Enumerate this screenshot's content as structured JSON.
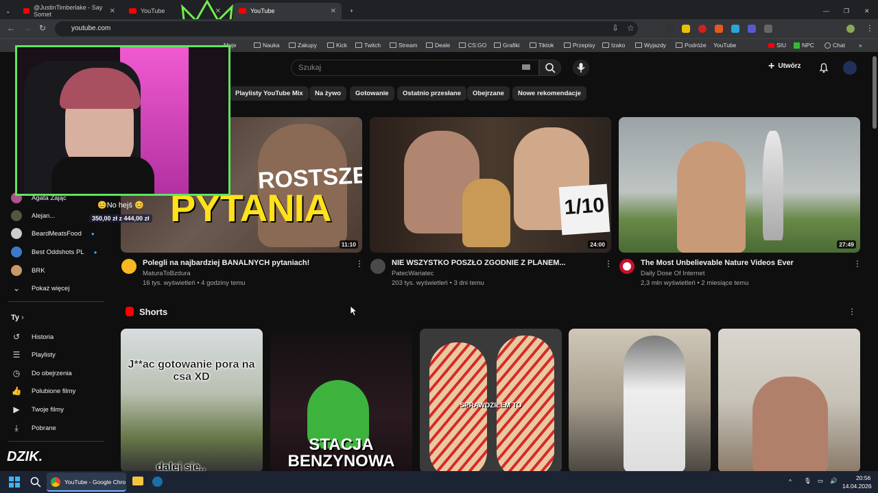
{
  "browser": {
    "tabs": [
      {
        "label": "@JustinTimberlake - Say Somet"
      },
      {
        "label": "YouTube"
      },
      {
        "label": "YouTube"
      }
    ],
    "url": "youtube.com",
    "bookmarks": [
      "Moje",
      "Nauka",
      "Zakupy",
      "Kick",
      "Twitch",
      "Stream",
      "Deale",
      "CS:GO",
      "Grafiki",
      "Tiktok",
      "Przepisy",
      "Izako",
      "Wyjazdy",
      "Podróże",
      "YouTube",
      "SIU",
      "NPC",
      "Chat"
    ]
  },
  "youtube": {
    "search_placeholder": "Szukaj",
    "create_label": "Utwórz",
    "chips": [
      "Playlisty YouTube Mix",
      "Na żywo",
      "Gotowanie",
      "Ostatnio przesłane",
      "Obejrzane",
      "Nowe rekomendacje"
    ],
    "videos": [
      {
        "title": "Polegli na najbardziej BANALNYCH pytaniach!",
        "channel": "MaturaToBzdura",
        "meta": "16 tys. wyświetleń • 4 godziny temu",
        "duration": "11:10",
        "thumb_text": "PYTANIA",
        "thumb_text2": "ROSTSZE"
      },
      {
        "title": "NIE WSZYSTKO POSZŁO ZGODNIE Z PLANEM...",
        "channel": "PatecWariatec",
        "meta": "203 tys. wyświetleń • 3 dni temu",
        "duration": "24:00",
        "thumb_text": "1/10"
      },
      {
        "title": "The Most Unbelievable Nature Videos Ever",
        "channel": "Daily Dose Of Internet",
        "meta": "2,3 mln wyświetleń • 2 miesiące temu",
        "duration": "27:49"
      }
    ],
    "shorts_title": "Shorts",
    "shorts": [
      {
        "text_top": "J**ac gotowanie pora na csa XD",
        "text_bottom": "dalej sie.."
      },
      {
        "text_bottom": "STACJA BENZYNOWA"
      },
      {
        "text_mid": "SPRAWDZIŁEM TO"
      },
      {},
      {}
    ]
  },
  "sidebar": {
    "subs": [
      {
        "label": "Agata Zając"
      },
      {
        "label": "Alejan..."
      },
      {
        "label": "BeardMeatsFood"
      },
      {
        "label": "Best Oddshots PL"
      },
      {
        "label": "BRK"
      }
    ],
    "show_more": "Pokaż więcej",
    "you_title": "Ty",
    "you_items": [
      "Historia",
      "Playlisty",
      "Do obejrzenia",
      "Polubione filmy",
      "Twoje filmy",
      "Pobrane"
    ]
  },
  "overlay": {
    "nohejs": "😊No hejś 😊",
    "price": "350,00 zł z 444,00 zł",
    "brand": "DZIK."
  },
  "taskbar": {
    "app_label": "YouTube - Google Chro",
    "time": "20:56",
    "date": "14.04.2026"
  }
}
